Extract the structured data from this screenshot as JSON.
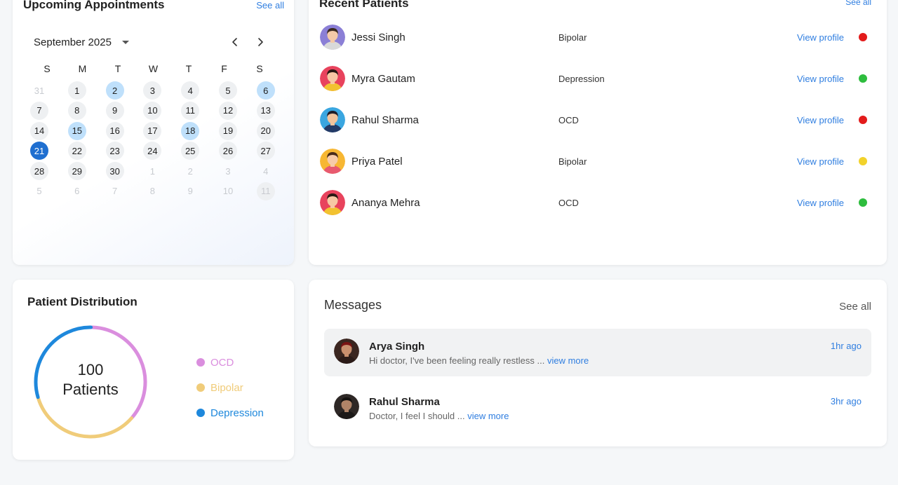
{
  "appointments": {
    "title": "Upcoming Appointments",
    "see_all": "See all",
    "month": "September 2025",
    "weekdays": [
      "S",
      "M",
      "T",
      "W",
      "T",
      "F",
      "S"
    ],
    "days": [
      {
        "label": "31",
        "state": "muted"
      },
      {
        "label": "1",
        "state": "normal"
      },
      {
        "label": "2",
        "state": "appt"
      },
      {
        "label": "3",
        "state": "normal"
      },
      {
        "label": "4",
        "state": "normal"
      },
      {
        "label": "5",
        "state": "normal"
      },
      {
        "label": "6",
        "state": "appt"
      },
      {
        "label": "7",
        "state": "normal"
      },
      {
        "label": "8",
        "state": "normal"
      },
      {
        "label": "9",
        "state": "normal"
      },
      {
        "label": "10",
        "state": "normal"
      },
      {
        "label": "11",
        "state": "normal"
      },
      {
        "label": "12",
        "state": "normal"
      },
      {
        "label": "13",
        "state": "normal"
      },
      {
        "label": "14",
        "state": "normal"
      },
      {
        "label": "15",
        "state": "appt"
      },
      {
        "label": "16",
        "state": "normal"
      },
      {
        "label": "17",
        "state": "normal"
      },
      {
        "label": "18",
        "state": "appt"
      },
      {
        "label": "19",
        "state": "normal"
      },
      {
        "label": "20",
        "state": "normal"
      },
      {
        "label": "21",
        "state": "today"
      },
      {
        "label": "22",
        "state": "normal"
      },
      {
        "label": "23",
        "state": "normal"
      },
      {
        "label": "24",
        "state": "normal"
      },
      {
        "label": "25",
        "state": "normal"
      },
      {
        "label": "26",
        "state": "normal"
      },
      {
        "label": "27",
        "state": "normal"
      },
      {
        "label": "28",
        "state": "normal"
      },
      {
        "label": "29",
        "state": "normal"
      },
      {
        "label": "30",
        "state": "normal"
      },
      {
        "label": "1",
        "state": "muted"
      },
      {
        "label": "2",
        "state": "muted"
      },
      {
        "label": "3",
        "state": "muted"
      },
      {
        "label": "4",
        "state": "muted"
      },
      {
        "label": "5",
        "state": "muted"
      },
      {
        "label": "6",
        "state": "muted"
      },
      {
        "label": "7",
        "state": "muted"
      },
      {
        "label": "8",
        "state": "muted"
      },
      {
        "label": "9",
        "state": "muted"
      },
      {
        "label": "10",
        "state": "muted"
      },
      {
        "label": "11",
        "state": "muted-ring"
      }
    ]
  },
  "patients": {
    "title": "Recent Patients",
    "see_all": "See all",
    "view_label": "View profile",
    "rows": [
      {
        "name": "Jessi Singh",
        "condition": "Bipolar",
        "status_color": "#e31b1b",
        "avatar": {
          "bg": "#8b7fd6",
          "skin": "#f4c9a8",
          "hair": "#3b2a20",
          "shirt": "#d9d9d9"
        }
      },
      {
        "name": "Myra Gautam",
        "condition": "Depression",
        "status_color": "#2ebd3e",
        "avatar": {
          "bg": "#e8435d",
          "skin": "#f7c8a4",
          "hair": "#2a1a14",
          "shirt": "#f2c230"
        }
      },
      {
        "name": "Rahul Sharma",
        "condition": "OCD",
        "status_color": "#e31b1b",
        "avatar": {
          "bg": "#3aa6e0",
          "skin": "#f1c39c",
          "hair": "#1e1e2a",
          "shirt": "#233a66"
        }
      },
      {
        "name": "Priya Patel",
        "condition": "Bipolar",
        "status_color": "#f2d22b",
        "avatar": {
          "bg": "#f7b733",
          "skin": "#f7cba9",
          "hair": "#4a2c1a",
          "shirt": "#e85a6f"
        }
      },
      {
        "name": "Ananya Mehra",
        "condition": "OCD",
        "status_color": "#2ebd3e",
        "avatar": {
          "bg": "#e8435d",
          "skin": "#f7c8a4",
          "hair": "#2a1a14",
          "shirt": "#f2c230"
        }
      }
    ]
  },
  "distribution": {
    "title": "Patient Distribution",
    "center_value": "100",
    "center_label": "Patients",
    "segments": [
      {
        "name": "OCD",
        "fraction": 0.36,
        "color": "#da8ede"
      },
      {
        "name": "Bipolar",
        "fraction": 0.34,
        "color": "#f0cc7a"
      },
      {
        "name": "Depression",
        "fraction": 0.3,
        "color": "#1e88dc"
      }
    ]
  },
  "messages": {
    "title": "Messages",
    "see_all": "See all",
    "more_label": "view more",
    "items": [
      {
        "name": "Arya Singh",
        "text": "Hi doctor, I've been feeling really restless ...",
        "time": "1hr ago",
        "active": true
      },
      {
        "name": "Rahul Sharma",
        "text": "Doctor, I feel I should ...",
        "time": "3hr ago",
        "active": false
      }
    ]
  }
}
